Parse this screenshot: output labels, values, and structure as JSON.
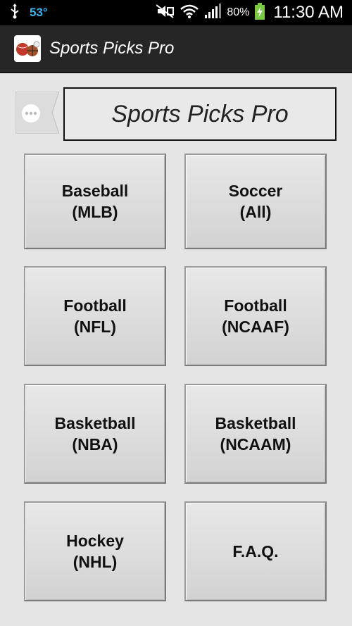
{
  "status_bar": {
    "temperature": "53°",
    "battery_percent": "80%",
    "time": "11:30 AM"
  },
  "action_bar": {
    "title": "Sports Picks Pro"
  },
  "banner": {
    "title": "Sports Picks Pro"
  },
  "tiles": [
    {
      "line1": "Baseball",
      "line2": "(MLB)"
    },
    {
      "line1": "Soccer",
      "line2": "(All)"
    },
    {
      "line1": "Football",
      "line2": "(NFL)"
    },
    {
      "line1": "Football",
      "line2": "(NCAAF)"
    },
    {
      "line1": "Basketball",
      "line2": "(NBA)"
    },
    {
      "line1": "Basketball",
      "line2": "(NCAAM)"
    },
    {
      "line1": "Hockey",
      "line2": "(NHL)"
    },
    {
      "line1": "F.A.Q.",
      "line2": ""
    }
  ],
  "colors": {
    "status_bar_bg": "#000000",
    "action_bar_bg": "#262626",
    "page_bg": "#e5e5e5",
    "temperature_accent": "#3fb3e8",
    "battery_green": "#7ac943"
  }
}
